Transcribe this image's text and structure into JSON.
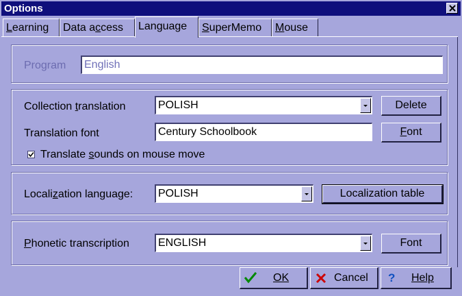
{
  "window": {
    "title": "Options"
  },
  "tabs": [
    {
      "label": "Learning",
      "u": "L",
      "rest": "earning"
    },
    {
      "label": "Data access",
      "pre": "Data a",
      "u": "c",
      "rest": "cess"
    },
    {
      "label": "Language",
      "active": true
    },
    {
      "label": "SuperMemo",
      "u": "S",
      "rest": "uperMemo"
    },
    {
      "label": "Mouse",
      "u": "M",
      "rest": "ouse"
    }
  ],
  "program": {
    "label": "Program",
    "value": "English"
  },
  "collection_translation": {
    "label_pre": "Collection ",
    "label_u": "t",
    "label_rest": "ranslation",
    "value": "POLISH",
    "delete_label": "Delete"
  },
  "translation_font": {
    "label": "Translation font",
    "value": "Century Schoolbook",
    "font_button_u": "F",
    "font_button_rest": "ont"
  },
  "translate_sounds": {
    "checked": true,
    "label_pre": "Translate ",
    "label_u": "s",
    "label_rest": "ounds on mouse move"
  },
  "localization": {
    "label_pre": "Locali",
    "label_u": "z",
    "label_rest": "ation language:",
    "value": "POLISH",
    "table_button": "Localization table"
  },
  "phonetic": {
    "label_u": "P",
    "label_rest": "honetic transcription",
    "value": "ENGLISH",
    "font_button": "Font"
  },
  "footer": {
    "ok_label": "OK",
    "cancel_label": "Cancel",
    "help_label": "Help"
  },
  "colors": {
    "titlebar": "#0f0f7c",
    "background": "#a6a6dc",
    "ok_icon": "#008800",
    "cancel_icon": "#cc0000",
    "help_icon": "#1050c0"
  }
}
